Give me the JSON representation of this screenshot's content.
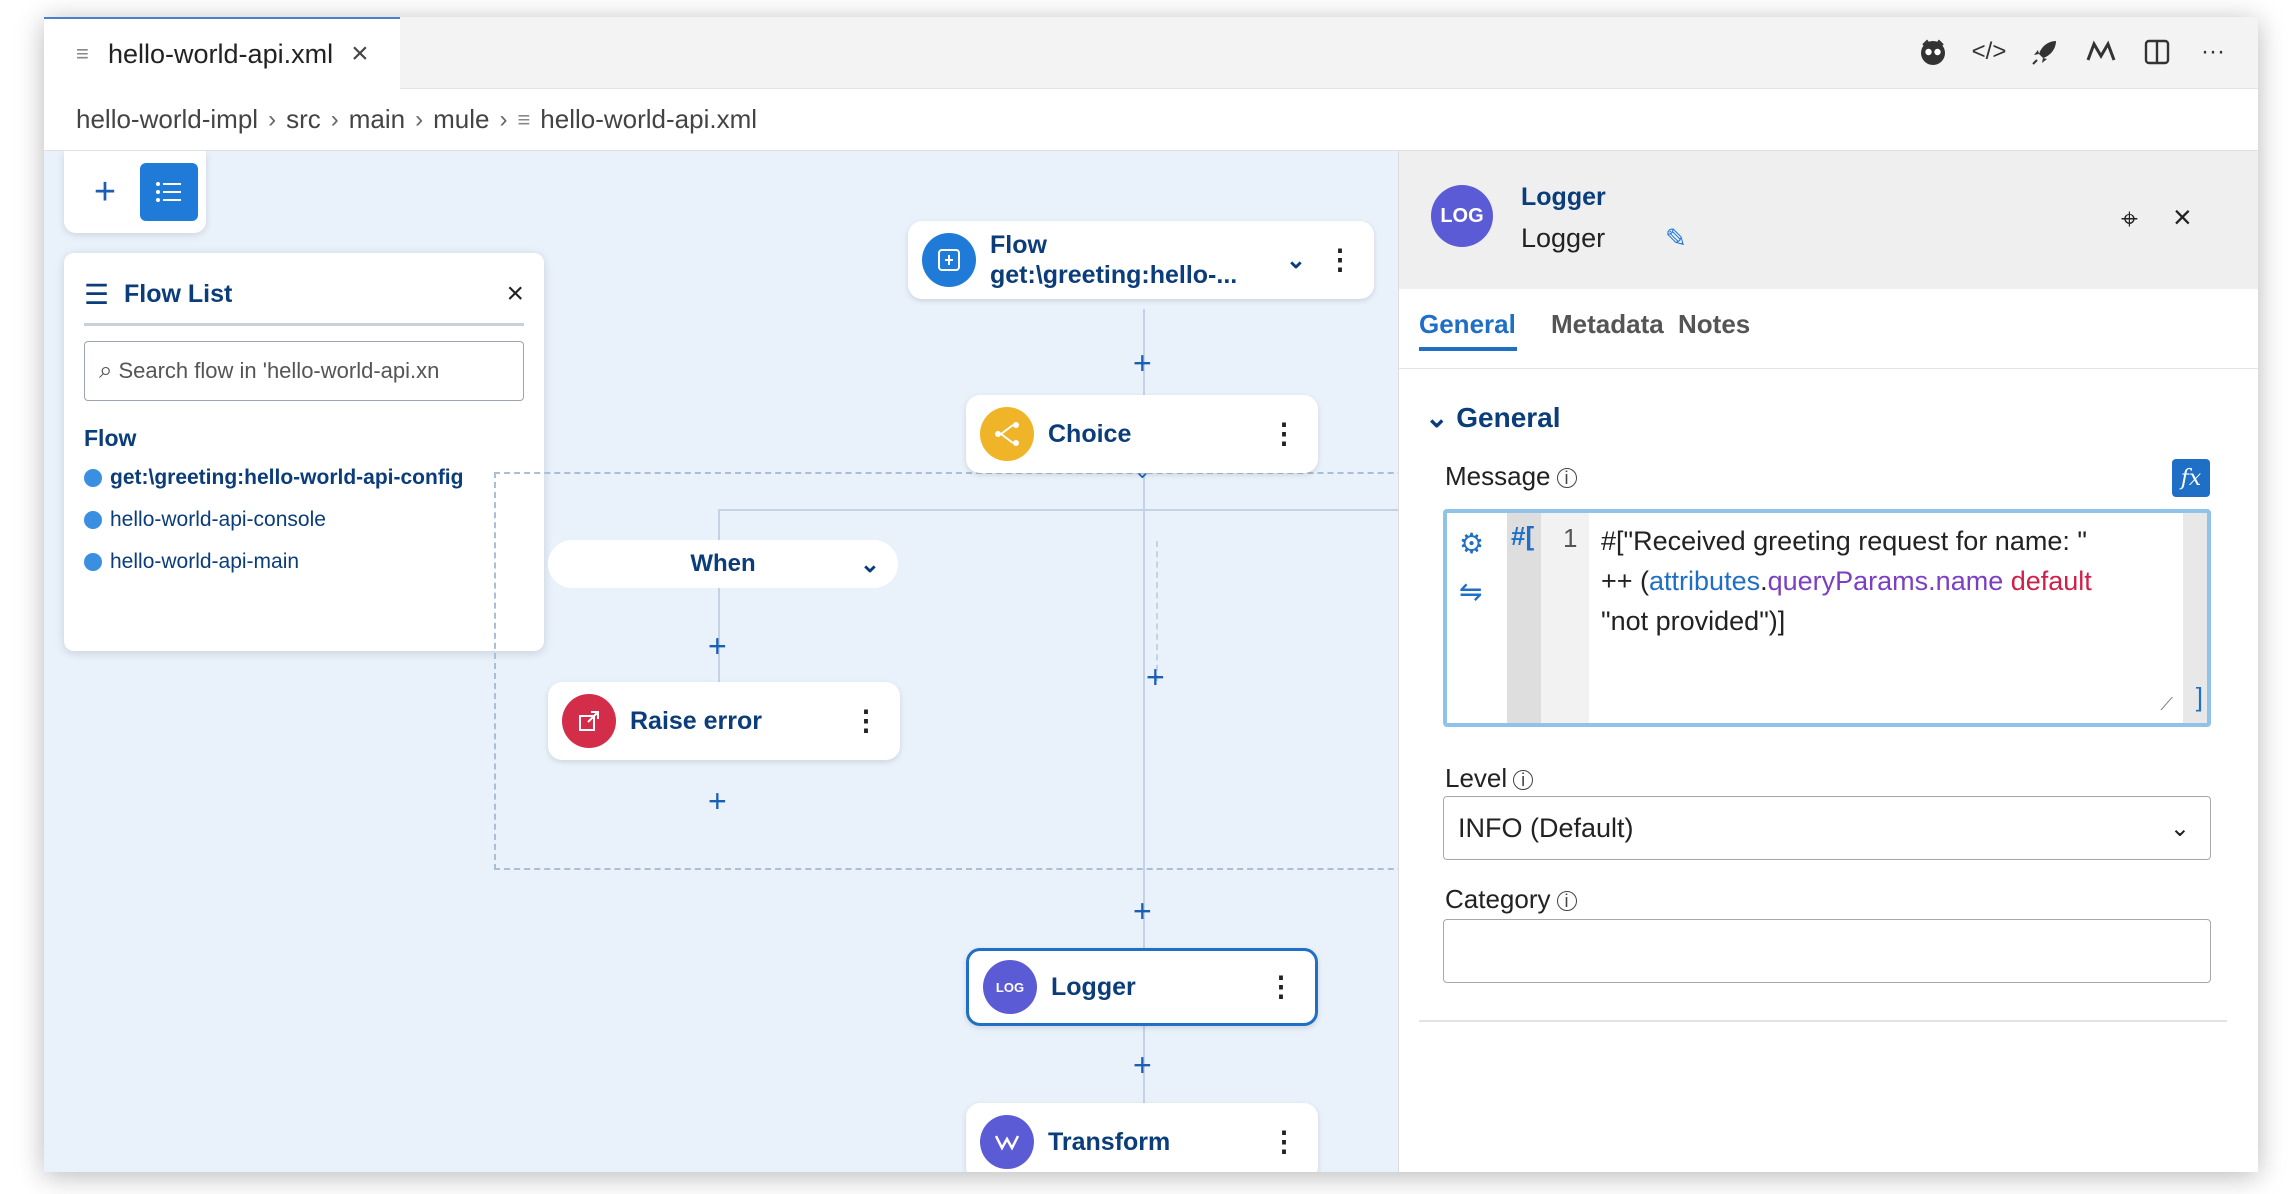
{
  "tab": {
    "title": "hello-world-api.xml",
    "close": "×"
  },
  "toolbar": {
    "icons": [
      "copilot-icon",
      "code-icon",
      "rocket-icon",
      "mule-icon",
      "split-editor-icon",
      "more-icon"
    ]
  },
  "breadcrumb": {
    "items": [
      "hello-world-impl",
      "src",
      "main",
      "mule",
      "hello-world-api.xml"
    ]
  },
  "canvas": {
    "add_label": "+",
    "flow_list": {
      "title": "Flow List",
      "search_placeholder": "Search flow in 'hello-world-api.xn",
      "category": "Flow",
      "items": [
        "get:\\greeting:hello-world-api-config",
        "hello-world-api-console",
        "hello-world-api-main"
      ]
    },
    "nodes": {
      "flow_type": "Flow",
      "flow_name": "get:\\greeting:hello-...",
      "choice": "Choice",
      "when": "When",
      "raise_error": "Raise error",
      "logger": "Logger",
      "transform": "Transform"
    }
  },
  "panel": {
    "component_type": "Logger",
    "component_name": "Logger",
    "tabs": [
      "General",
      "Metadata",
      "Notes"
    ],
    "section": "General",
    "message": {
      "label": "Message",
      "fx": "fx",
      "prefix": "#[",
      "line_number": "1",
      "code_line1": "#[\"Received greeting request for name: \"",
      "code_line2_op": "++ (",
      "code_line2_attr": "attributes",
      "code_line2_dot": ".",
      "code_line2_prop": "queryParams.name",
      "code_line2_kw": " default",
      "code_line3": "\"not provided\")]",
      "close_bracket": "]"
    },
    "level": {
      "label": "Level",
      "value": "INFO (Default)"
    },
    "category": {
      "label": "Category",
      "value": ""
    }
  },
  "colors": {
    "accent": "#1f6fc6",
    "canvas_bg": "#e9f1fb",
    "choice": "#f0b429",
    "raise_error": "#d42d4a",
    "logger": "#5b5bd6",
    "flow": "#1f7ad8"
  }
}
